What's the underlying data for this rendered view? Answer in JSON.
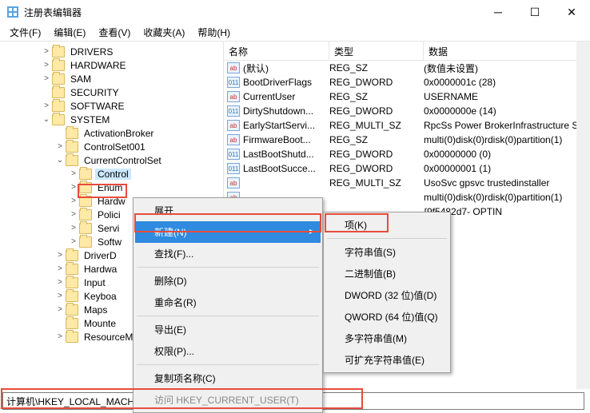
{
  "window": {
    "title": "注册表编辑器"
  },
  "menu": {
    "file": "文件(F)",
    "edit": "编辑(E)",
    "view": "查看(V)",
    "favorites": "收藏夹(A)",
    "help": "帮助(H)"
  },
  "tree": {
    "items": [
      {
        "label": "DRIVERS",
        "indent": 3,
        "caret": "closed"
      },
      {
        "label": "HARDWARE",
        "indent": 3,
        "caret": "closed"
      },
      {
        "label": "SAM",
        "indent": 3,
        "caret": "closed"
      },
      {
        "label": "SECURITY",
        "indent": 3,
        "caret": "none"
      },
      {
        "label": "SOFTWARE",
        "indent": 3,
        "caret": "closed"
      },
      {
        "label": "SYSTEM",
        "indent": 3,
        "caret": "open"
      },
      {
        "label": "ActivationBroker",
        "indent": 4,
        "caret": "none"
      },
      {
        "label": "ControlSet001",
        "indent": 4,
        "caret": "closed"
      },
      {
        "label": "CurrentControlSet",
        "indent": 4,
        "caret": "open"
      },
      {
        "label": "Control",
        "indent": 5,
        "caret": "closed",
        "selected": true
      },
      {
        "label": "Enum",
        "indent": 5,
        "caret": "closed"
      },
      {
        "label": "Hardw",
        "indent": 5,
        "caret": "closed"
      },
      {
        "label": "Polici",
        "indent": 5,
        "caret": "closed"
      },
      {
        "label": "Servi",
        "indent": 5,
        "caret": "closed"
      },
      {
        "label": "Softw",
        "indent": 5,
        "caret": "closed"
      },
      {
        "label": "DriverD",
        "indent": 4,
        "caret": "closed"
      },
      {
        "label": "Hardwa",
        "indent": 4,
        "caret": "closed"
      },
      {
        "label": "Input",
        "indent": 4,
        "caret": "closed"
      },
      {
        "label": "Keyboa",
        "indent": 4,
        "caret": "closed"
      },
      {
        "label": "Maps",
        "indent": 4,
        "caret": "closed"
      },
      {
        "label": "Mounte",
        "indent": 4,
        "caret": "none"
      },
      {
        "label": "ResourceManager",
        "indent": 4,
        "caret": "closed"
      }
    ]
  },
  "list": {
    "headers": {
      "name": "名称",
      "type": "类型",
      "data": "数据"
    },
    "rows": [
      {
        "icon": "str",
        "name": "(默认)",
        "type": "REG_SZ",
        "data": "(数值未设置)"
      },
      {
        "icon": "bin",
        "name": "BootDriverFlags",
        "type": "REG_DWORD",
        "data": "0x0000001c (28)"
      },
      {
        "icon": "str",
        "name": "CurrentUser",
        "type": "REG_SZ",
        "data": "USERNAME"
      },
      {
        "icon": "bin",
        "name": "DirtyShutdown...",
        "type": "REG_DWORD",
        "data": "0x0000000e (14)"
      },
      {
        "icon": "str",
        "name": "EarlyStartServi...",
        "type": "REG_MULTI_SZ",
        "data": "RpcSs Power BrokerInfrastructure S"
      },
      {
        "icon": "str",
        "name": "FirmwareBoot...",
        "type": "REG_SZ",
        "data": "multi(0)disk(0)rdisk(0)partition(1)"
      },
      {
        "icon": "bin",
        "name": "LastBootShutd...",
        "type": "REG_DWORD",
        "data": "0x00000000 (0)"
      },
      {
        "icon": "bin",
        "name": "LastBootSucce...",
        "type": "REG_DWORD",
        "data": "0x00000001 (1)"
      },
      {
        "icon": "str",
        "name": "",
        "type": "REG_MULTI_SZ",
        "data": "UsoSvc gpsvc trustedinstaller"
      },
      {
        "icon": "str",
        "name": "",
        "type": "",
        "data": "multi(0)disk(0)rdisk(0)partition(1)"
      },
      {
        "icon": "str",
        "name": "",
        "type": "",
        "data": "{9f5482d7-  OPTIN"
      }
    ]
  },
  "context_menu": {
    "expand": "展开",
    "new": "新建(N)",
    "find": "查找(F)...",
    "delete": "删除(D)",
    "rename": "重命名(R)",
    "export": "导出(E)",
    "permissions": "权限(P)...",
    "copy_key_name": "复制项名称(C)",
    "goto_hkcu": "访问 HKEY_CURRENT_USER(T)"
  },
  "submenu": {
    "key": "项(K)",
    "string": "字符串值(S)",
    "binary": "二进制值(B)",
    "dword": "DWORD (32 位)值(D)",
    "qword": "QWORD (64 位)值(Q)",
    "multi_string": "多字符串值(M)",
    "expandable_string": "可扩充字符串值(E)"
  },
  "address": "计算机\\HKEY_LOCAL_MACHINE\\SYSTEM\\CurrentControlSet\\Control"
}
